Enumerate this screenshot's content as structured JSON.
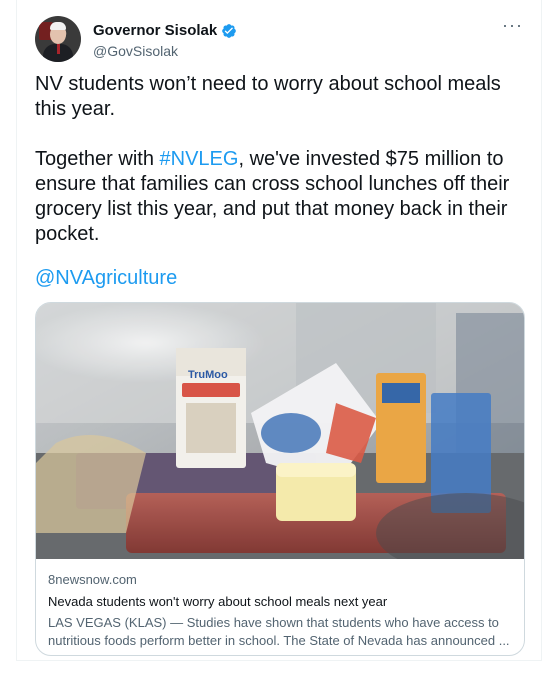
{
  "tweet": {
    "display_name": "Governor Sisolak",
    "handle": "@GovSisolak",
    "more_label": "···",
    "text": {
      "line1": "NV students won’t need to worry about school meals this year.",
      "p2_before": "Together with ",
      "hashtag": "#NVLEG",
      "p2_after": ", we've invested $75 million to ensure that families can cross school lunches off their grocery list this year, and put that money back in their pocket."
    },
    "mention": "@NVAgriculture"
  },
  "link_card": {
    "domain": "8newsnow.com",
    "title": "Nevada students won't worry about school meals next year",
    "description": "LAS VEGAS (KLAS) — Studies have shown that students who have access to nutritious foods perform better in school. The State of Nevada has announced ...",
    "image_label": "TruMoo"
  },
  "colors": {
    "link": "#1d9bf0",
    "secondary_text": "#536471",
    "verified_badge": "#1d9bf0"
  },
  "icons": {
    "verified": "verified-badge-icon",
    "more": "more-options-icon"
  }
}
